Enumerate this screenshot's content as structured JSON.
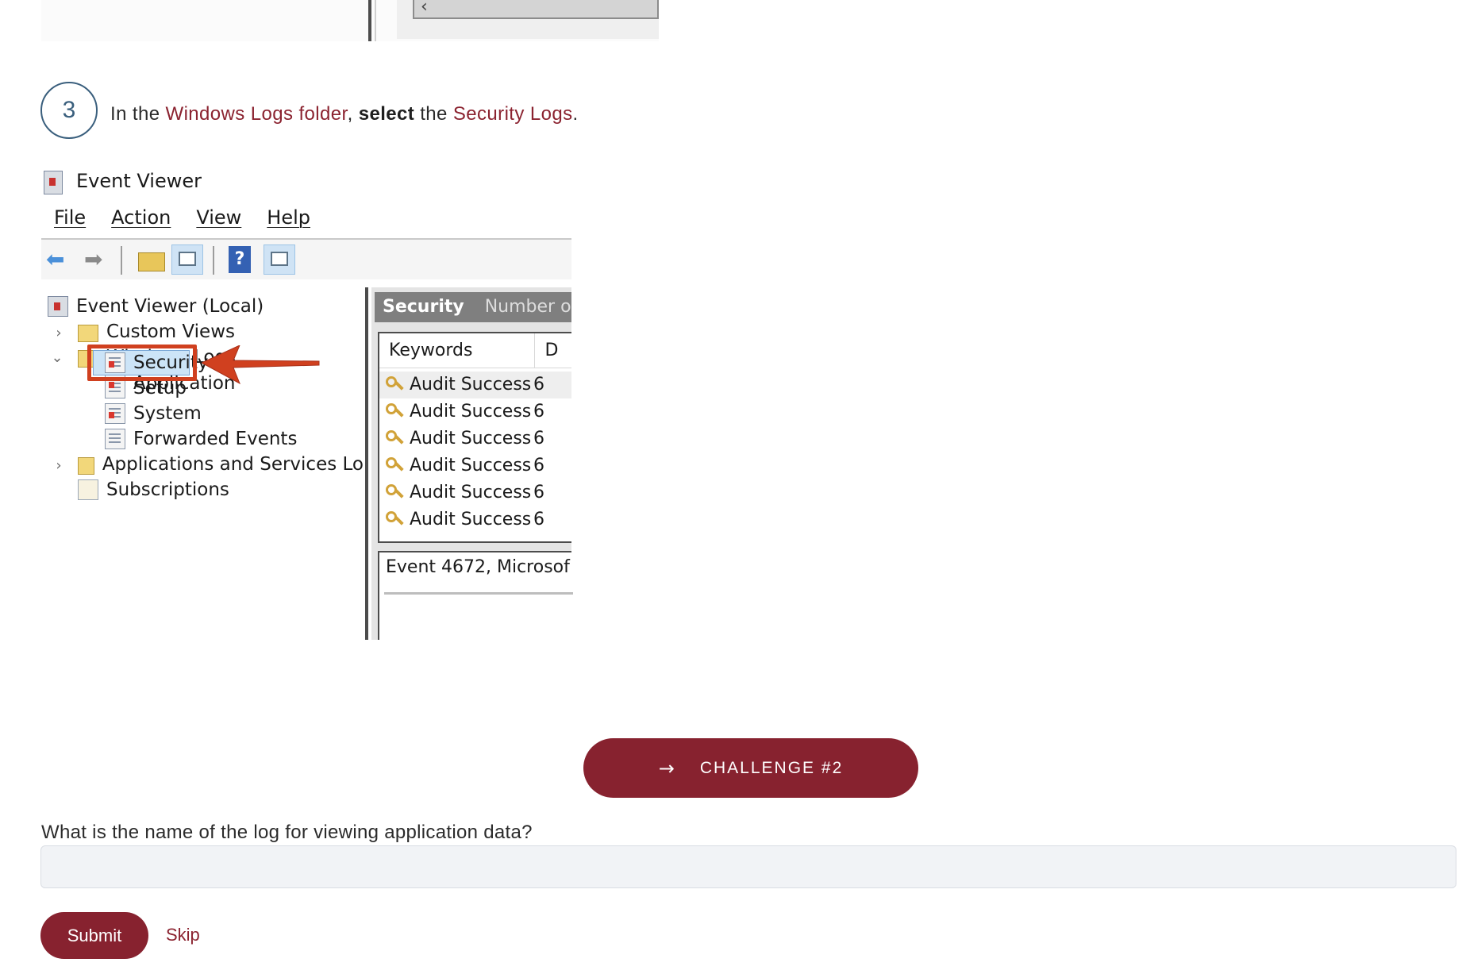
{
  "step": {
    "number": "3",
    "prefix": "In the ",
    "folder_link": "Windows Logs folder",
    "comma": ", ",
    "action": "select",
    "middle": " the ",
    "target_link": "Security Logs",
    "suffix": "."
  },
  "event_viewer": {
    "window_title": "Event Viewer",
    "menu": [
      "File",
      "Action",
      "View",
      "Help"
    ],
    "tree": {
      "root": "Event Viewer (Local)",
      "custom_views": "Custom Views",
      "windows_logs": "Windows Logs",
      "application": "Application",
      "security": "Security",
      "setup": "Setup",
      "system": "System",
      "forwarded_events": "Forwarded Events",
      "apps_services": "Applications and Services Lo",
      "subscriptions": "Subscriptions"
    },
    "right_panel": {
      "header_title": "Security",
      "header_count": "Number o",
      "column_keywords": "Keywords",
      "column_next": "D",
      "rows": [
        {
          "keyword": "Audit Success",
          "trail": "6"
        },
        {
          "keyword": "Audit Success",
          "trail": "6"
        },
        {
          "keyword": "Audit Success",
          "trail": "6"
        },
        {
          "keyword": "Audit Success",
          "trail": "6"
        },
        {
          "keyword": "Audit Success",
          "trail": "6"
        },
        {
          "keyword": "Audit Success",
          "trail": "6"
        }
      ],
      "detail_title": "Event 4672, Microsof"
    }
  },
  "challenge": {
    "arrow": "→",
    "label": "CHALLENGE #2"
  },
  "question": {
    "text": "What is the name of the log for viewing application data?",
    "answer_value": "",
    "answer_placeholder": ""
  },
  "actions": {
    "submit": "Submit",
    "skip": "Skip"
  },
  "colors": {
    "brand": "#87222f",
    "link": "#8b2330",
    "step_circle": "#3a5f7d",
    "highlight_box": "#d0401f"
  }
}
